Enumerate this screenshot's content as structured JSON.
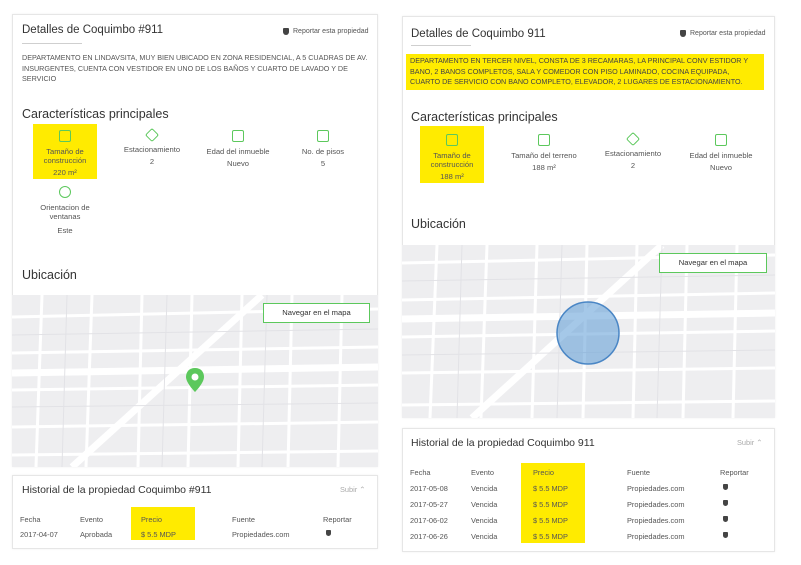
{
  "left": {
    "title": "Detalles de Coquimbo #911",
    "report_label": "Reportar esta propiedad",
    "description": "DEPARTAMENTO EN LINDAVSITA, MUY BIEN UBICADO EN ZONA RESIDENCIAL, A 5 CUADRAS DE AV. INSURGENTES, CUENTA CON VESTIDOR EN UNO DE LOS BAÑOS Y CUARTO DE LAVADO Y DE SERVICIO",
    "features_heading": "Características principales",
    "features": [
      {
        "label": "Tamaño de construcción",
        "value": "220 m²",
        "icon": "building-size-icon",
        "highlight": true
      },
      {
        "label": "Estacionamiento",
        "value": "2",
        "icon": "parking-icon",
        "highlight": false
      },
      {
        "label": "Edad del inmueble",
        "value": "Nuevo",
        "icon": "calendar-icon",
        "highlight": false
      },
      {
        "label": "No. de pisos",
        "value": "5",
        "icon": "floors-icon",
        "highlight": false
      },
      {
        "label": "Orientacion de ventanas",
        "value": "Este",
        "icon": "compass-icon",
        "highlight": false
      }
    ],
    "location_heading": "Ubicación",
    "map_button": "Navegar en el mapa",
    "history_title": "Historial de la propiedad Coquimbo #911",
    "history_toggle": "Subir ⌃",
    "columns": [
      "Fecha",
      "Evento",
      "Precio",
      "Fuente",
      "Reportar"
    ],
    "rows": [
      {
        "fecha": "2017-04-07",
        "evento": "Aprobada",
        "precio": "$ 5.5 MDP",
        "fuente": "Propiedades.com"
      }
    ]
  },
  "right": {
    "title": "Detalles de Coquimbo 911",
    "report_label": "Reportar esta propiedad",
    "description": "DEPARTAMENTO EN TERCER NIVEL, CONSTA DE 3 RECAMARAS, LA PRINCIPAL CONV ESTIDOR Y BANO, 2 BANOS COMPLETOS, SALA Y COMEDOR CON PISO LAMINADO, COCINA EQUIPADA, CUARTO DE SERVICIO CON BANO COMPLETO, ELEVADOR, 2 LUGARES DE ESTACIONAMIENTO.",
    "features_heading": "Características principales",
    "features": [
      {
        "label": "Tamaño de construcción",
        "value": "188 m²",
        "icon": "building-size-icon",
        "highlight": true
      },
      {
        "label": "Tamaño del terreno",
        "value": "188 m²",
        "icon": "land-size-icon",
        "highlight": false
      },
      {
        "label": "Estacionamiento",
        "value": "2",
        "icon": "parking-icon",
        "highlight": false
      },
      {
        "label": "Edad del inmueble",
        "value": "Nuevo",
        "icon": "calendar-icon",
        "highlight": false
      }
    ],
    "location_heading": "Ubicación",
    "map_button": "Navegar en el mapa",
    "history_title": "Historial de la propiedad Coquimbo 911",
    "history_toggle": "Subir ⌃",
    "columns": [
      "Fecha",
      "Evento",
      "Precio",
      "Fuente",
      "Reportar"
    ],
    "rows": [
      {
        "fecha": "2017-05-08",
        "evento": "Vencida",
        "precio": "$ 5.5 MDP",
        "fuente": "Propiedades.com"
      },
      {
        "fecha": "2017-05-27",
        "evento": "Vencida",
        "precio": "$ 5.5 MDP",
        "fuente": "Propiedades.com"
      },
      {
        "fecha": "2017-06-02",
        "evento": "Vencida",
        "precio": "$ 5.5 MDP",
        "fuente": "Propiedades.com"
      },
      {
        "fecha": "2017-06-26",
        "evento": "Vencida",
        "precio": "$ 5.5 MDP",
        "fuente": "Propiedades.com"
      }
    ]
  },
  "colors": {
    "accent": "#5cc85c",
    "highlight": "#ffeb00",
    "map_bg": "#eeeef0",
    "area_circle": "#5b9bd5"
  }
}
